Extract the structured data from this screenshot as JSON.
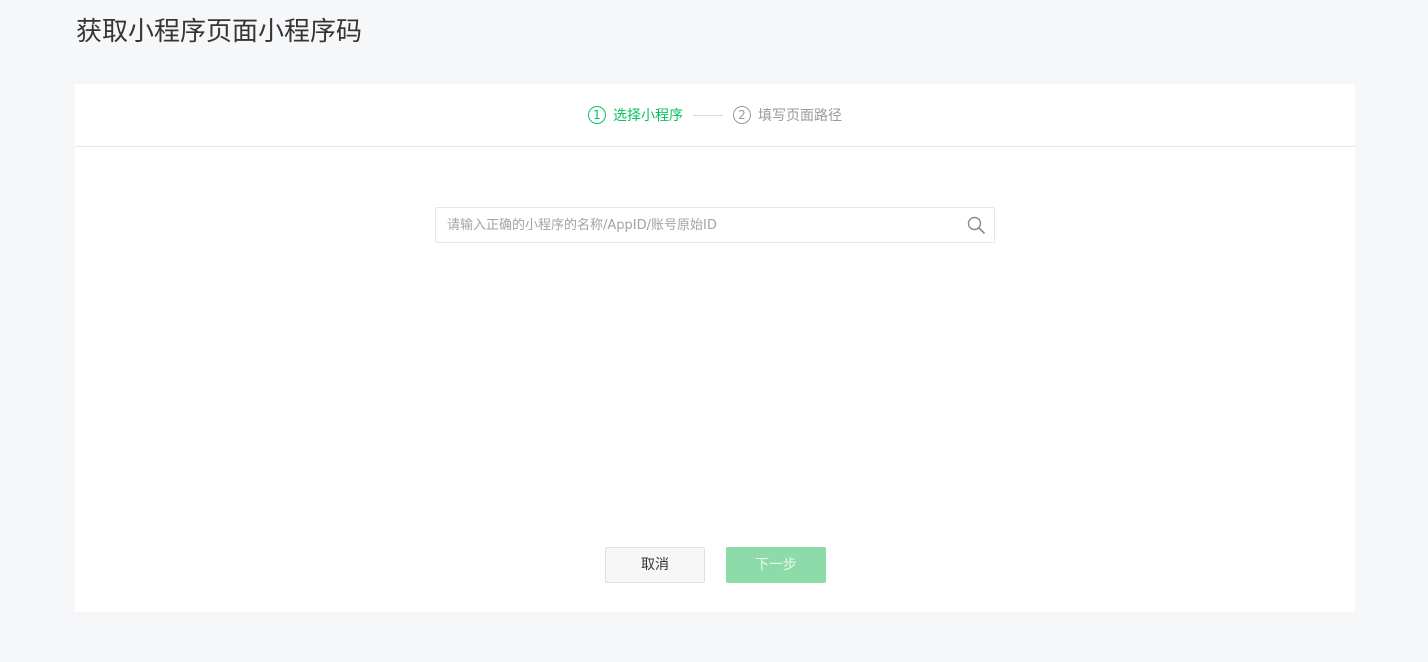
{
  "page": {
    "title": "获取小程序页面小程序码"
  },
  "steps": [
    {
      "number": "1",
      "label": "选择小程序",
      "active": true
    },
    {
      "number": "2",
      "label": "填写页面路径",
      "active": false
    }
  ],
  "search": {
    "value": "",
    "placeholder": "请输入正确的小程序的名称/AppID/账号原始ID",
    "icon": "search-icon"
  },
  "actions": {
    "cancel_label": "取消",
    "next_label": "下一步",
    "next_disabled": true
  },
  "colors": {
    "accent": "#07c160",
    "accent_disabled": "#8ddba8",
    "inactive": "#9a9a9a",
    "background": "#f6f7f9"
  }
}
